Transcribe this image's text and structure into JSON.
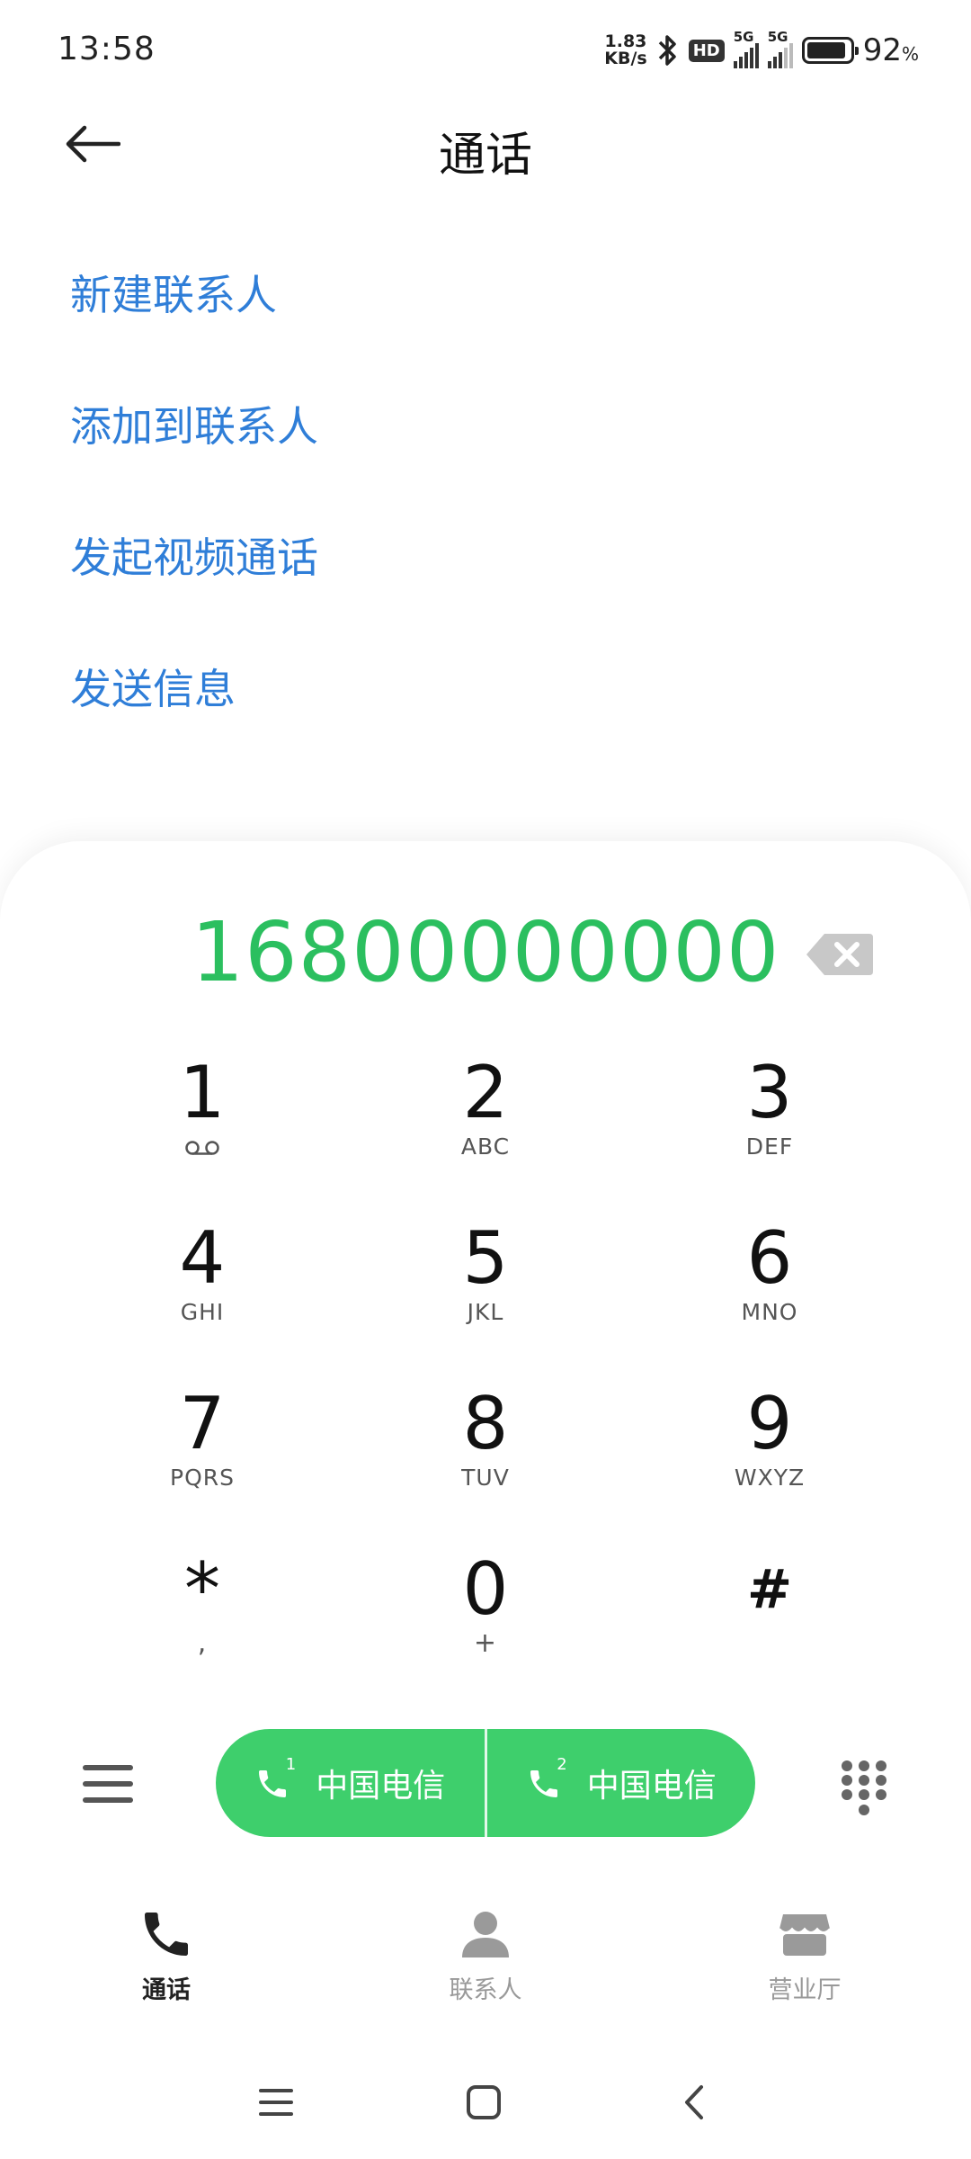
{
  "status_bar": {
    "time": "13:58",
    "net_speed_value": "1.83",
    "net_speed_unit": "KB/s",
    "hd_badge": "HD",
    "sim1_type": "5G",
    "sim2_type": "5G",
    "battery_percent": "92",
    "battery_symbol": "%"
  },
  "header": {
    "title": "通话",
    "back_icon": "back-arrow-icon"
  },
  "actions": [
    {
      "label": "新建联系人"
    },
    {
      "label": "添加到联系人"
    },
    {
      "label": "发起视频通话"
    },
    {
      "label": "发送信息"
    }
  ],
  "dialer": {
    "number": "16800000000",
    "number_color": "#2bbf5f",
    "backspace_icon": "backspace-icon"
  },
  "keypad": {
    "keys": [
      {
        "digit": "1",
        "letters": "",
        "icon": "voicemail-icon"
      },
      {
        "digit": "2",
        "letters": "ABC"
      },
      {
        "digit": "3",
        "letters": "DEF"
      },
      {
        "digit": "4",
        "letters": "GHI"
      },
      {
        "digit": "5",
        "letters": "JKL"
      },
      {
        "digit": "6",
        "letters": "MNO"
      },
      {
        "digit": "7",
        "letters": "PQRS"
      },
      {
        "digit": "8",
        "letters": "TUV"
      },
      {
        "digit": "9",
        "letters": "WXYZ"
      },
      {
        "digit": "*",
        "letters": ","
      },
      {
        "digit": "0",
        "letters": "+"
      },
      {
        "digit": "#",
        "letters": ""
      }
    ]
  },
  "call_bar": {
    "menu_icon": "menu-icon",
    "sim1_label": "中国电信",
    "sim1_index": "1",
    "sim2_label": "中国电信",
    "sim2_index": "2",
    "call_color": "#3ecf6c",
    "dialpad_icon": "dialpad-icon"
  },
  "bottom_nav": {
    "items": [
      {
        "label": "通话",
        "icon": "phone-icon",
        "active": true
      },
      {
        "label": "联系人",
        "icon": "contacts-icon",
        "active": false
      },
      {
        "label": "营业厅",
        "icon": "store-icon",
        "active": false
      }
    ]
  },
  "system_nav": {
    "recents_icon": "recents-icon",
    "home_icon": "home-icon",
    "back_icon": "system-back-icon"
  }
}
